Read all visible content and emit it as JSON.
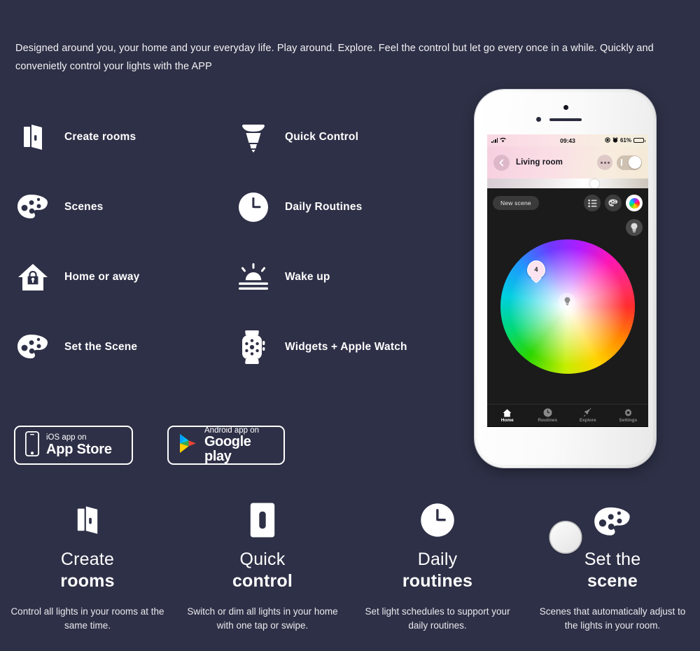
{
  "intro": {
    "text": "Designed around you, your home and your everyday life. Play around. Explore. Feel the control but let go every once in a while. Quickly and convenietly control your lights with the  APP"
  },
  "features_left": [
    {
      "icon": "door-icon",
      "label": "Create rooms"
    },
    {
      "icon": "palette-icon",
      "label": "Scenes"
    },
    {
      "icon": "house-lock-icon",
      "label": "Home or away"
    },
    {
      "icon": "palette-icon",
      "label": "Set the Scene"
    }
  ],
  "features_right": [
    {
      "icon": "bulb-icon",
      "label": "Quick Control"
    },
    {
      "icon": "clock-icon",
      "label": "Daily Routines"
    },
    {
      "icon": "sunrise-icon",
      "label": "Wake up"
    },
    {
      "icon": "apple-watch-icon",
      "label": "Widgets + Apple Watch"
    }
  ],
  "badges": {
    "ios": {
      "icon": "iphone-icon",
      "top": "iOS app on",
      "name": "App Store"
    },
    "android": {
      "icon": "play-triangle-icon",
      "top": "Android app on",
      "name": "Google play"
    }
  },
  "phone": {
    "statusbar": {
      "signal_icon": "signal-bars-icon",
      "wifi_icon": "wifi-icon",
      "time": "09:43",
      "location_icon": "location-icon",
      "alarm_icon": "alarm-icon",
      "battery_percent": "61%",
      "battery_icon": "battery-icon"
    },
    "header": {
      "back_icon": "chevron-left-icon",
      "title": "Living room",
      "more_icon": "ellipsis-icon",
      "power_toggle": "on",
      "brightness_percent": 72
    },
    "toolbar": {
      "new_scene": "New scene",
      "list_icon": "list-icon",
      "palette_icon": "palette-icon",
      "color-wheel_icon": "color-wheel-icon",
      "bulb_icon": "bulb-icon"
    },
    "wheel": {
      "pin_label": "4",
      "bulb_marker_icon": "bulb-icon"
    },
    "tabs": [
      {
        "icon": "home-icon",
        "label": "Home",
        "active": true
      },
      {
        "icon": "clock-icon",
        "label": "Routines",
        "active": false
      },
      {
        "icon": "rocket-icon",
        "label": "Explore",
        "active": false
      },
      {
        "icon": "gear-icon",
        "label": "Settings",
        "active": false
      }
    ]
  },
  "bottom_cards": [
    {
      "icon": "door-icon",
      "title_light": "Create",
      "title_bold": "rooms",
      "desc": "Control all lights in your rooms at the same time."
    },
    {
      "icon": "light-switch-icon",
      "title_light": "Quick",
      "title_bold": "control",
      "desc": "Switch or dim all lights in your home with one tap or swipe."
    },
    {
      "icon": "clock-icon",
      "title_light": "Daily",
      "title_bold": "routines",
      "desc": "Set light schedules to support your daily routines."
    },
    {
      "icon": "palette-icon",
      "title_light": "Set the",
      "title_bold": "scene",
      "desc": "Scenes that automatically adjust to the lights in your room."
    }
  ],
  "colors": {
    "background": "#2e3047",
    "text": "#ffffff",
    "phone_body": "#f2f2f2",
    "app_dark": "#1b1b1b",
    "header_pink": "#f7cfdf"
  }
}
